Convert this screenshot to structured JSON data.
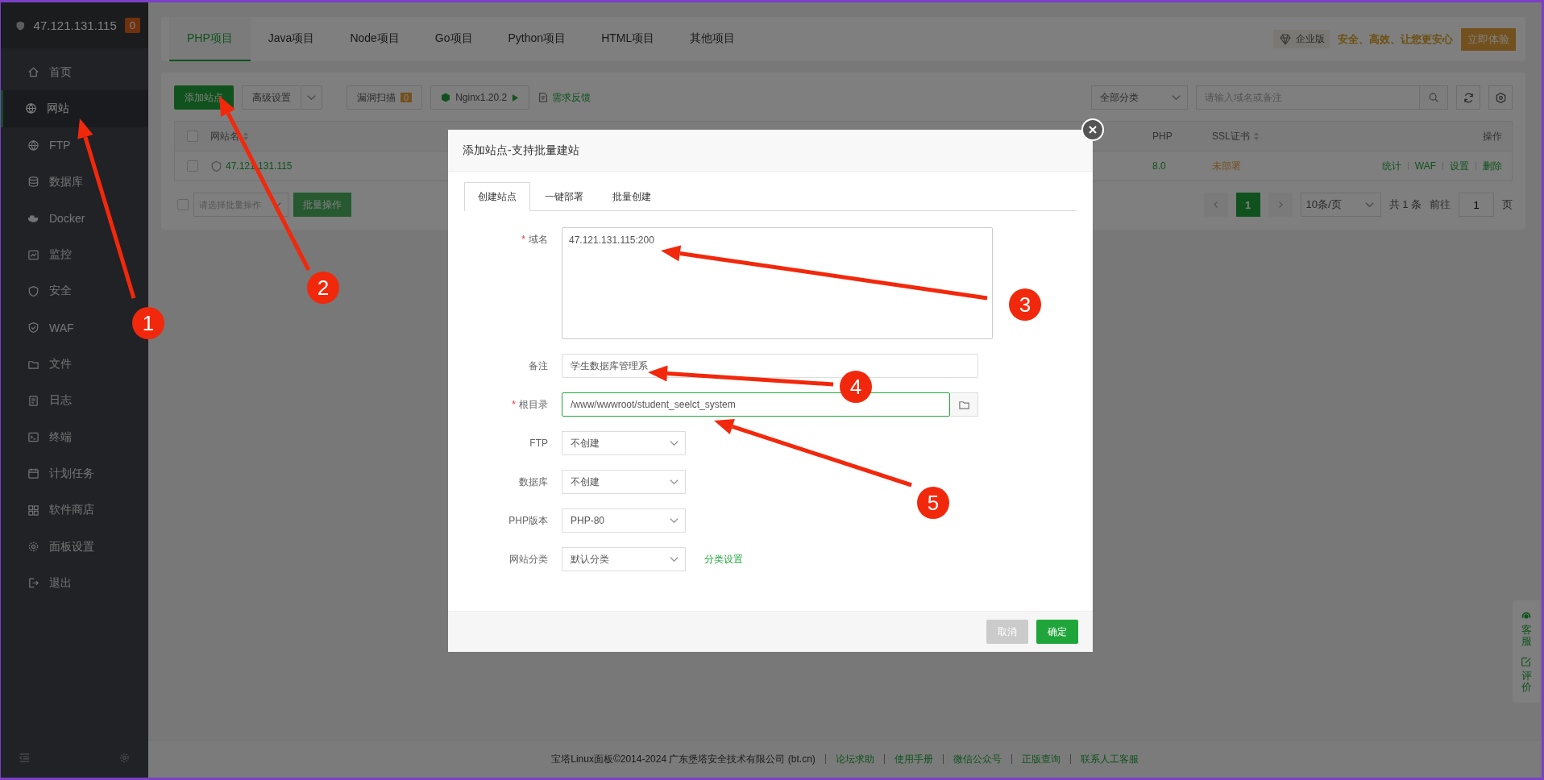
{
  "sidebar": {
    "host": "47.121.131.115",
    "alert_count": "0",
    "items": [
      {
        "label": "首页",
        "selected": false
      },
      {
        "label": "网站",
        "selected": true
      },
      {
        "label": "FTP",
        "selected": false
      },
      {
        "label": "数据库",
        "selected": false
      },
      {
        "label": "Docker",
        "selected": false
      },
      {
        "label": "监控",
        "selected": false
      },
      {
        "label": "安全",
        "selected": false
      },
      {
        "label": "WAF",
        "selected": false
      },
      {
        "label": "文件",
        "selected": false
      },
      {
        "label": "日志",
        "selected": false
      },
      {
        "label": "终端",
        "selected": false
      },
      {
        "label": "计划任务",
        "selected": false
      },
      {
        "label": "软件商店",
        "selected": false
      },
      {
        "label": "面板设置",
        "selected": false
      },
      {
        "label": "退出",
        "selected": false
      }
    ]
  },
  "project_tabs": [
    {
      "label": "PHP项目",
      "selected": true
    },
    {
      "label": "Java项目",
      "selected": false
    },
    {
      "label": "Node项目",
      "selected": false
    },
    {
      "label": "Go项目",
      "selected": false
    },
    {
      "label": "Python项目",
      "selected": false
    },
    {
      "label": "HTML项目",
      "selected": false
    },
    {
      "label": "其他项目",
      "selected": false
    }
  ],
  "promo": {
    "edition": "企业版",
    "slogan": "安全、高效、让您更安心",
    "button": "立即体验"
  },
  "toolbar": {
    "add_site": "添加站点",
    "advanced": "高级设置",
    "scan": "漏洞扫描",
    "scan_count": "0",
    "nginx": "Nginx1.20.2",
    "feedback": "需求反馈",
    "category": "全部分类",
    "search_placeholder": "请输入域名或备注"
  },
  "table": {
    "select_all_checked": false,
    "columns": [
      "网站名",
      "PHP",
      "SSL证书",
      "操作"
    ],
    "rows": [
      {
        "checked": false,
        "name": "47.121.131.115",
        "php": "8.0",
        "ssl": "未部署",
        "actions": [
          "统计",
          "WAF",
          "设置",
          "删除"
        ]
      }
    ]
  },
  "batch": {
    "checked": false,
    "placeholder": "请选择批量操作",
    "button": "批量操作"
  },
  "pagination": {
    "pages": [
      {
        "label": "1",
        "selected": true
      }
    ],
    "page_size": "10条/页",
    "total": "共 1 条",
    "goto": "前往",
    "goto_value": "1",
    "unit": "页"
  },
  "footer": {
    "copyright": "宝塔Linux面板©2014-2024 广东堡塔安全技术有限公司 (bt.cn)",
    "links": [
      "论坛求助",
      "使用手册",
      "微信公众号",
      "正版查询",
      "联系人工客服"
    ]
  },
  "side_widget": [
    "客服",
    "评价"
  ],
  "dialog": {
    "title": "添加站点-支持批量建站",
    "required_mark": "*",
    "tabs": [
      {
        "label": "创建站点",
        "selected": true
      },
      {
        "label": "一键部署",
        "selected": false
      },
      {
        "label": "批量创建",
        "selected": false
      }
    ],
    "fields": [
      {
        "kind": "textarea",
        "label": "域名",
        "required": true,
        "focused": false,
        "value": "47.121.131.115:200"
      },
      {
        "kind": "input",
        "label": "备注",
        "required": false,
        "focused": false,
        "value": "学生数据库管理系"
      },
      {
        "kind": "path",
        "label": "根目录",
        "required": true,
        "focused": true,
        "value": "/www/wwwroot/student_seelct_system"
      },
      {
        "kind": "select",
        "label": "FTP",
        "required": false,
        "focused": false,
        "value": "不创建"
      },
      {
        "kind": "select",
        "label": "数据库",
        "required": false,
        "focused": false,
        "value": "不创建"
      },
      {
        "kind": "select",
        "label": "PHP版本",
        "required": false,
        "focused": false,
        "value": "PHP-80"
      },
      {
        "kind": "select",
        "label": "网站分类",
        "required": false,
        "focused": false,
        "value": "默认分类",
        "link": "分类设置"
      }
    ],
    "buttons": [
      {
        "label": "取消",
        "kind": "cancel"
      },
      {
        "label": "确定",
        "kind": "primary"
      }
    ]
  },
  "annotations": [
    "1",
    "2",
    "3",
    "4",
    "5"
  ]
}
